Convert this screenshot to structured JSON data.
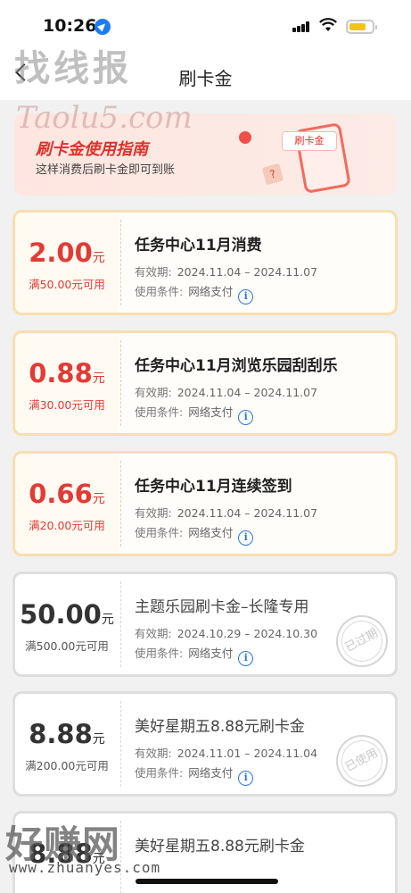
{
  "status_bar": {
    "time": "10:26"
  },
  "header": {
    "title": "刷卡金"
  },
  "watermarks": {
    "top": "找线报",
    "url": "Taolu5.com",
    "bottom_brand": "好赚网",
    "bottom_url": "www.zhuanyes.com"
  },
  "guide": {
    "title": "刷卡金使用指南",
    "subtitle": "这样消费后刷卡金即可到账",
    "tag": "刷卡金",
    "qmark": "?"
  },
  "labels": {
    "valid_period": "有效期:",
    "use_condition": "使用条件:",
    "currency_unit": "元"
  },
  "coupons": [
    {
      "amount": "2.00",
      "min_spend": "满50.00元可用",
      "title": "任务中心11月消费",
      "valid": "2024.11.04 – 2024.11.07",
      "condition": "网络支付",
      "status": ""
    },
    {
      "amount": "0.88",
      "min_spend": "满30.00元可用",
      "title": "任务中心11月浏览乐园刮刮乐",
      "valid": "2024.11.04 – 2024.11.07",
      "condition": "网络支付",
      "status": ""
    },
    {
      "amount": "0.66",
      "min_spend": "满20.00元可用",
      "title": "任务中心11月连续签到",
      "valid": "2024.11.04 – 2024.11.07",
      "condition": "网络支付",
      "status": ""
    },
    {
      "amount": "50.00",
      "min_spend": "满500.00元可用",
      "title": "主题乐园刷卡金–长隆专用",
      "valid": "2024.10.29 – 2024.10.30",
      "condition": "网络支付",
      "status": "已过期"
    },
    {
      "amount": "8.88",
      "min_spend": "满200.00元可用",
      "title": "美好星期五8.88元刷卡金",
      "valid": "2024.11.01 – 2024.11.04",
      "condition": "网络支付",
      "status": "已使用"
    },
    {
      "amount": "8.88",
      "min_spend": "",
      "title": "美好星期五8.88元刷卡金",
      "valid": "",
      "condition": "",
      "status": ""
    }
  ],
  "colors": {
    "accent_red": "#e23b35",
    "info_blue": "#2e78d6",
    "active_border": "#f8dfb0"
  }
}
